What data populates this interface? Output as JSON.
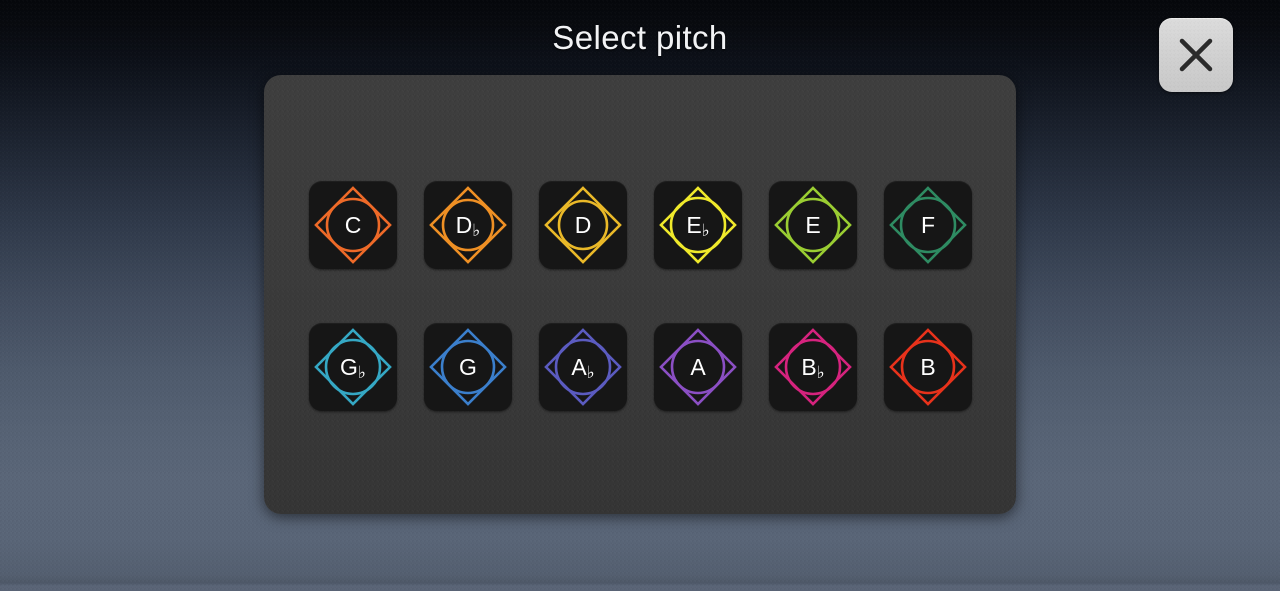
{
  "dialog": {
    "title": "Select pitch",
    "close_button": {
      "label": "Close",
      "icon": "close-x-icon",
      "fill": "#d4d4d4",
      "stroke": "#2b2b2b"
    },
    "panel": {
      "background": "#3b3b3b"
    }
  },
  "background": {
    "top_color": "#05070b",
    "bottom_color": "#596375"
  },
  "pitches": [
    {
      "id": "C",
      "letter": "C",
      "accidental": "",
      "label": "C",
      "color": "#ee6a28",
      "circle_r": 26
    },
    {
      "id": "Db",
      "letter": "D",
      "accidental": "♭",
      "label": "D♭",
      "color": "#ef9024",
      "circle_r": 25
    },
    {
      "id": "D",
      "letter": "D",
      "accidental": "",
      "label": "D",
      "color": "#eab928",
      "circle_r": 24
    },
    {
      "id": "Eb",
      "letter": "E",
      "accidental": "♭",
      "label": "E♭",
      "color": "#efe92b",
      "circle_r": 27
    },
    {
      "id": "E",
      "letter": "E",
      "accidental": "",
      "label": "E",
      "color": "#9acd32",
      "circle_r": 26
    },
    {
      "id": "F",
      "letter": "F",
      "accidental": "",
      "label": "F",
      "color": "#2e8b62",
      "circle_r": 27
    },
    {
      "id": "Gb",
      "letter": "G",
      "accidental": "♭",
      "label": "G♭",
      "color": "#35a8c4",
      "circle_r": 27
    },
    {
      "id": "G",
      "letter": "G",
      "accidental": "",
      "label": "G",
      "color": "#3b7fcc",
      "circle_r": 26
    },
    {
      "id": "Ab",
      "letter": "A",
      "accidental": "♭",
      "label": "A♭",
      "color": "#5b5bc0",
      "circle_r": 27
    },
    {
      "id": "A",
      "letter": "A",
      "accidental": "",
      "label": "A",
      "color": "#8b4fc4",
      "circle_r": 26
    },
    {
      "id": "Bb",
      "letter": "B",
      "accidental": "♭",
      "label": "B♭",
      "color": "#d6237e",
      "circle_r": 27
    },
    {
      "id": "B",
      "letter": "B",
      "accidental": "",
      "label": "B",
      "color": "#e8321b",
      "circle_r": 26
    }
  ]
}
